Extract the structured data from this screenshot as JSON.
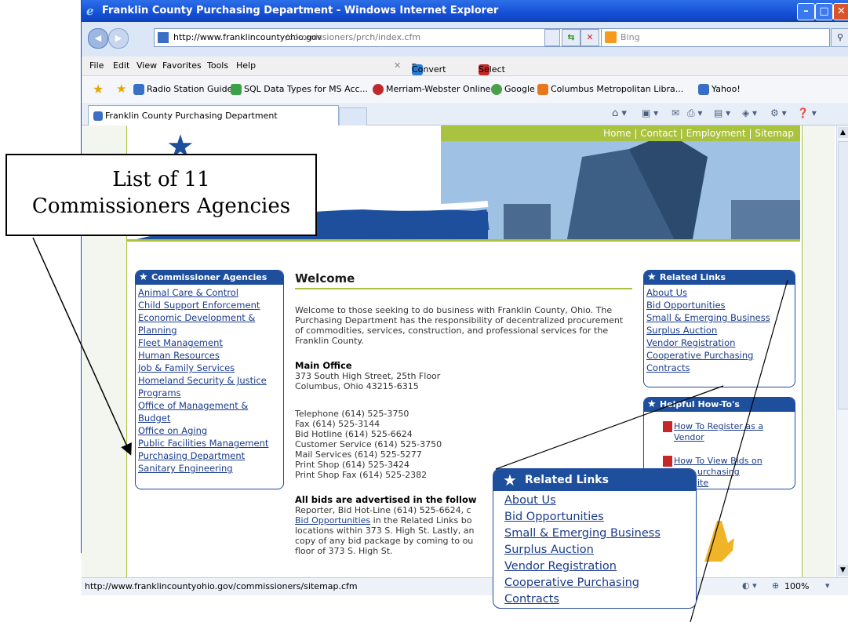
{
  "window": {
    "title": "Franklin County Purchasing Department - Windows Internet Explorer",
    "url_host": "http://www.franklincountyohio.gov",
    "url_path": "/commissioners/prch/index.cfm",
    "search_placeholder": "Bing"
  },
  "menu": [
    "File",
    "Edit",
    "View",
    "Favorites",
    "Tools",
    "Help"
  ],
  "toolbar": {
    "convert_label": "Convert",
    "select_label": "Select"
  },
  "favorites": [
    "Radio Station Guide",
    "SQL Data Types for MS Acc...",
    "Merriam-Webster Online",
    "Google",
    "Columbus Metropolitan Libra...",
    "Yahoo!"
  ],
  "tab": {
    "label": "Franklin County Purchasing Department"
  },
  "site": {
    "topnav": "Home | Contact | Employment | Sitemap",
    "agencies_title": "Commissioner Agencies",
    "agencies": [
      "Animal Care & Control",
      "Child Support Enforcement",
      "Economic Development &",
      "Planning",
      "Fleet Management",
      "Human Resources",
      "Job & Family Services",
      "Homeland Security & Justice",
      "Programs",
      "Office of Management &",
      "Budget",
      "Office on Aging",
      "Public Facilities Management",
      "Purchasing Department",
      "Sanitary Engineering"
    ],
    "welcome_heading": "Welcome",
    "welcome_text": "Welcome to those seeking to do business with Franklin County, Ohio. The Purchasing Department has the responsibility of decentralized procurement of commodities, services, construction, and professional services for the Franklin County.",
    "main_office_heading": "Main Office",
    "address": [
      "373 South High Street, 25th Floor",
      "Columbus, Ohio 43215-6315"
    ],
    "phones": [
      "Telephone (614) 525-3750",
      "Fax (614) 525-3144",
      "Bid Hotline (614) 525-6624",
      "Customer Service (614) 525-3750",
      "Mail Services (614) 525-5277",
      "Print Shop (614) 525-3424",
      "Print Shop Fax (614) 525-2382"
    ],
    "bids_heading": "All bids are advertised in the follow",
    "bids_lines": [
      "Reporter, Bid Hot-Line (614) 525-6624, c",
      "Bid Opportunities",
      " in the Related Links bo",
      "locations within 373 S. High St. Lastly, an",
      "copy of any bid package by coming to ou",
      "floor of 373 S. High St."
    ],
    "related_title": "Related Links",
    "related_links": [
      "About Us",
      "Bid Opportunities",
      "Small & Emerging Business",
      "Surplus Auction",
      "Vendor Registration",
      "Cooperative Purchasing",
      "Contracts"
    ],
    "howto_title": "Helpful How-To's",
    "howto_links": [
      [
        "How To Register as a",
        "Vendor"
      ],
      [
        "How To View Bids on",
        "urchasing",
        "ite"
      ]
    ]
  },
  "status": {
    "url": "http://www.franklincountyohio.gov/commissioners/sitemap.cfm",
    "zoom": "100%"
  },
  "callout": [
    "List of 11",
    "Commissioners Agencies"
  ],
  "colors": {
    "title_bar": "#1450d6",
    "site_blue": "#1d4f9d",
    "site_green": "#a9c23f"
  }
}
